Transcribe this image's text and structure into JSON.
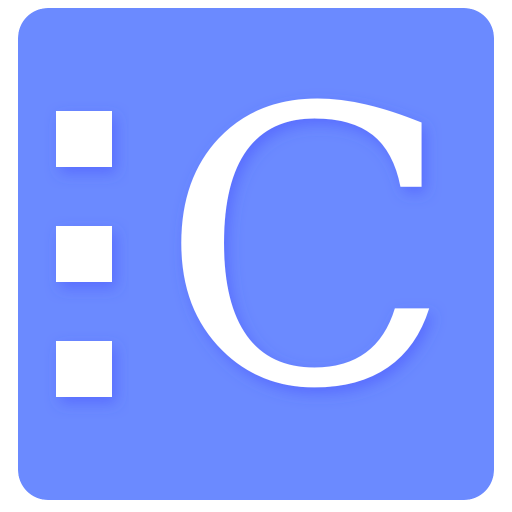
{
  "app_icon": {
    "glyph": "C",
    "colors": {
      "tile_background": "#6b8aff",
      "foreground": "#ffffff",
      "shadow": "#4a55ff"
    },
    "list_markers_count": 3
  }
}
